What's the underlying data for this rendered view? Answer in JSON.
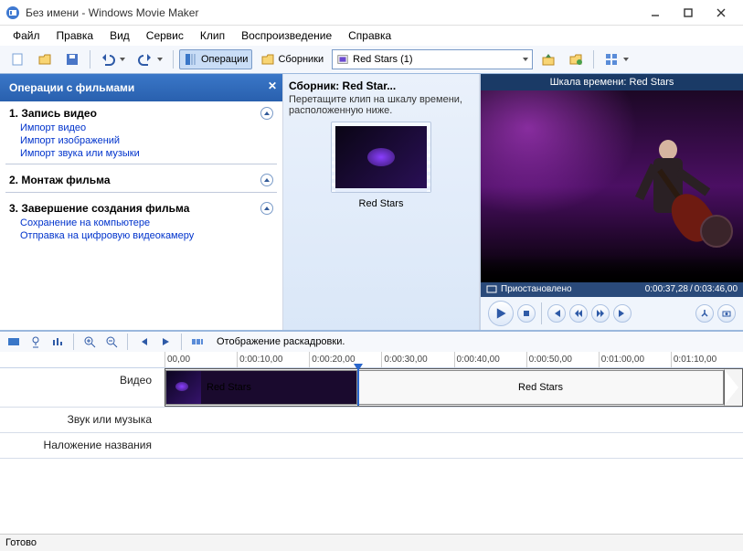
{
  "window": {
    "title": "Без имени - Windows Movie Maker"
  },
  "menu": {
    "file": "Файл",
    "edit": "Правка",
    "view": "Вид",
    "tools": "Сервис",
    "clip": "Клип",
    "play": "Воспроизведение",
    "help": "Справка"
  },
  "toolbar": {
    "operations": "Операции",
    "collections": "Сборники",
    "combo_selected": "Red Stars (1)"
  },
  "taskpane": {
    "header": "Операции с фильмами",
    "sec1": "1. Запись видео",
    "links1": [
      "Импорт видео",
      "Импорт изображений",
      "Импорт звука или музыки"
    ],
    "sec2": "2. Монтаж фильма",
    "sec3": "3. Завершение создания фильма",
    "links3": [
      "Сохранение на компьютере",
      "Отправка на цифровую видеокамеру"
    ]
  },
  "collection": {
    "title": "Сборник: Red Star...",
    "hint": "Перетащите клип на шкалу времени, расположенную ниже.",
    "thumb_label": "Red Stars"
  },
  "preview": {
    "title": "Шкала времени: Red Stars",
    "status": "Приостановлено",
    "time_current": "0:00:37,28",
    "time_total": "0:03:46,00"
  },
  "timeline": {
    "toolbar_label": "Отображение раскадровки.",
    "ruler": [
      "00,00",
      "0:00:10,00",
      "0:00:20,00",
      "0:00:30,00",
      "0:00:40,00",
      "0:00:50,00",
      "0:01:00,00",
      "0:01:10,00"
    ],
    "tracks": {
      "video": "Видео",
      "audio": "Звук или музыка",
      "title": "Наложение названия"
    },
    "clip1": "Red Stars",
    "clip2": "Red Stars"
  },
  "status": "Готово"
}
